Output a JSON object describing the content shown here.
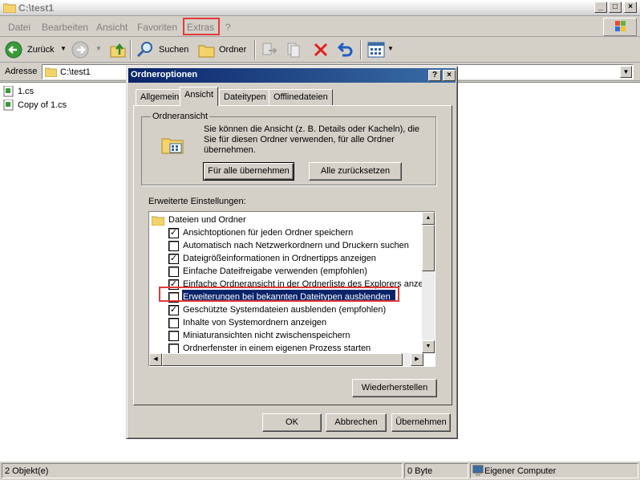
{
  "window": {
    "title": "C:\\test1",
    "controls": {
      "minimize": "_",
      "maximize": "□",
      "close": "×"
    }
  },
  "menubar": {
    "items": [
      "Datei",
      "Bearbeiten",
      "Ansicht",
      "Favoriten",
      "Extras",
      "?"
    ]
  },
  "toolbar": {
    "back_label": "Zurück",
    "search_label": "Suchen",
    "folders_label": "Ordner"
  },
  "address": {
    "label": "Adresse",
    "value": "C:\\test1"
  },
  "files": [
    {
      "name": "1.cs"
    },
    {
      "name": "Copy of 1.cs"
    }
  ],
  "statusbar": {
    "objects": "2 Objekt(e)",
    "size": "0 Byte",
    "location": "Eigener Computer"
  },
  "dialog": {
    "title": "Ordneroptionen",
    "help_btn": "?",
    "close_btn": "×",
    "tabs": [
      "Allgemein",
      "Ansicht",
      "Dateitypen",
      "Offlinedateien"
    ],
    "active_tab": "Ansicht",
    "folder_view": {
      "label": "Ordneransicht",
      "description": "Sie können die Ansicht (z. B. Details oder Kacheln), die Sie für diesen Ordner verwenden, für alle Ordner übernehmen.",
      "apply_all": "Für alle übernehmen",
      "reset_all": "Alle zurücksetzen"
    },
    "advanced_label": "Erweiterte Einstellungen:",
    "tree": {
      "root": "Dateien und Ordner",
      "items": [
        {
          "label": "Ansichtoptionen für jeden Ordner speichern",
          "checked": true
        },
        {
          "label": "Automatisch nach Netzwerkordnern und Druckern suchen",
          "checked": false
        },
        {
          "label": "Dateigrößeinformationen in Ordnertipps anzeigen",
          "checked": true
        },
        {
          "label": "Einfache Dateifreigabe verwenden (empfohlen)",
          "checked": false
        },
        {
          "label": "Einfache Ordneransicht in der Ordnerliste des Explorers anzeigen",
          "checked": true
        },
        {
          "label": "Erweiterungen bei bekannten Dateitypen ausblenden",
          "checked": false,
          "selected": true
        },
        {
          "label": "Geschützte Systemdateien ausblenden (empfohlen)",
          "checked": true
        },
        {
          "label": "Inhalte von Systemordnern anzeigen",
          "checked": false
        },
        {
          "label": "Miniaturansichten nicht zwischenspeichern",
          "checked": false
        },
        {
          "label": "Ordnerfenster in einem eigenen Prozess starten",
          "checked": false
        }
      ]
    },
    "restore": "Wiederherstellen",
    "ok": "OK",
    "cancel": "Abbrechen",
    "apply": "Übernehmen"
  },
  "colors": {
    "highlight_box": "#e23a3a",
    "selection": "#0a246a",
    "dialog_title": "#0a246a"
  }
}
